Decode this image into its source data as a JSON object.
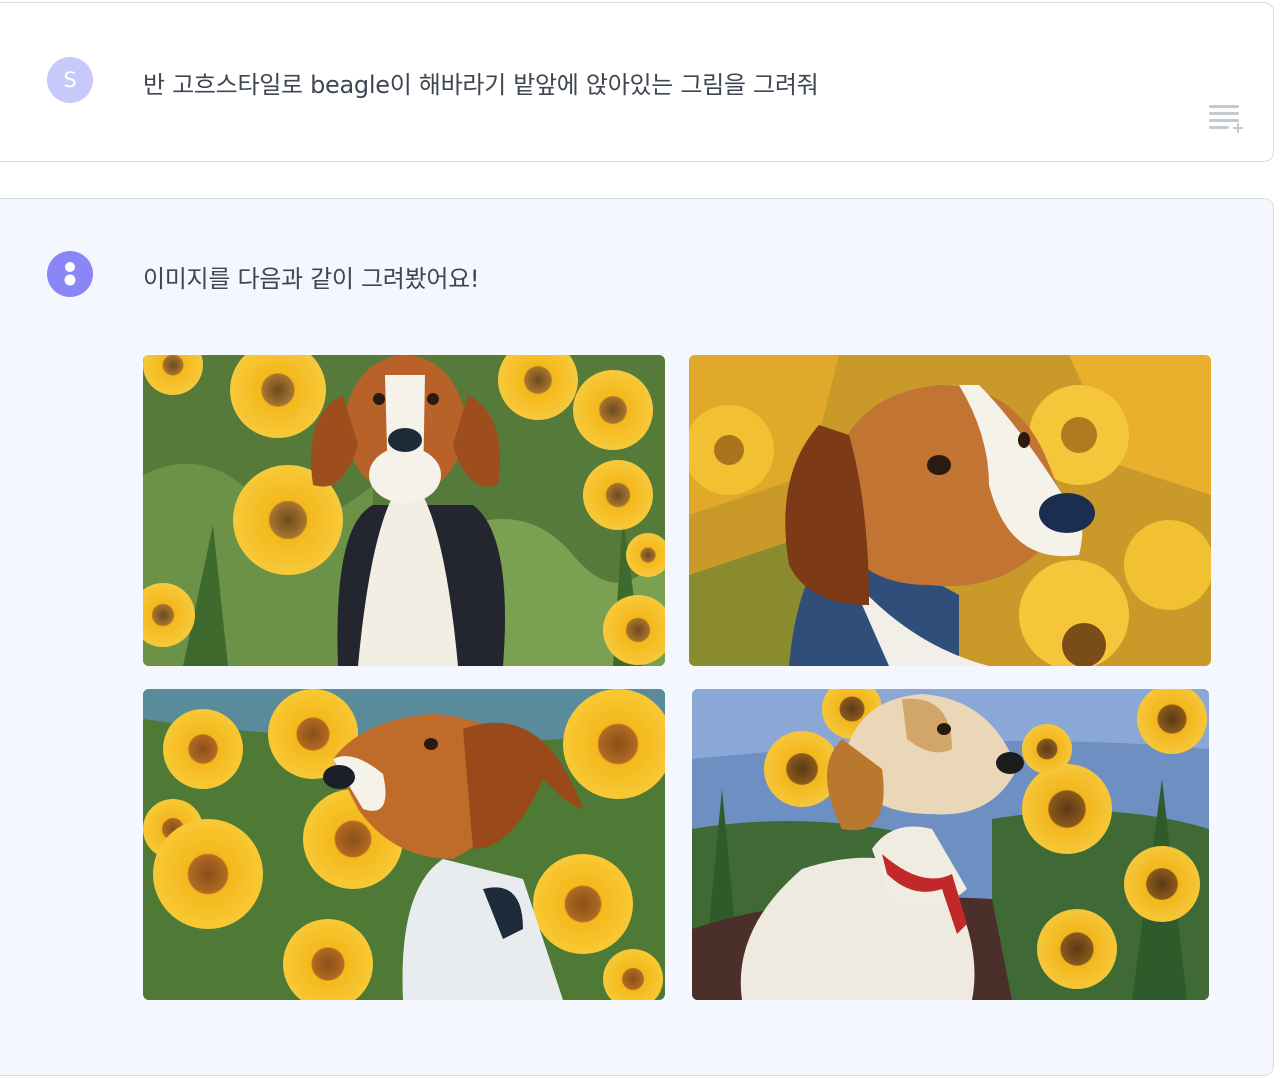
{
  "user_message": {
    "avatar_initial": "S",
    "text": "반 고흐스타일로 beagle이 해바라기 밭앞에 앉아있는 그림을 그려줘",
    "action_icon": "playlist-add-icon"
  },
  "assistant_message": {
    "avatar_icon": "assistant-logo-icon",
    "text": "이미지를 다음과 같이 그려봤어요!",
    "images": [
      {
        "name": "image-1",
        "subject": "beagle sitting front-facing among sunflowers"
      },
      {
        "name": "image-2",
        "subject": "beagle head in profile facing right among sunflowers"
      },
      {
        "name": "image-3",
        "subject": "beagle in profile facing left among sunflowers"
      },
      {
        "name": "image-4",
        "subject": "white dog with red collar in sunflower field, blue sky"
      }
    ]
  },
  "colors": {
    "user_avatar": "#c7c9fb",
    "assistant_avatar": "#8b86f5",
    "assistant_bg": "#f4f7fd",
    "border": "#d7dbe2"
  }
}
